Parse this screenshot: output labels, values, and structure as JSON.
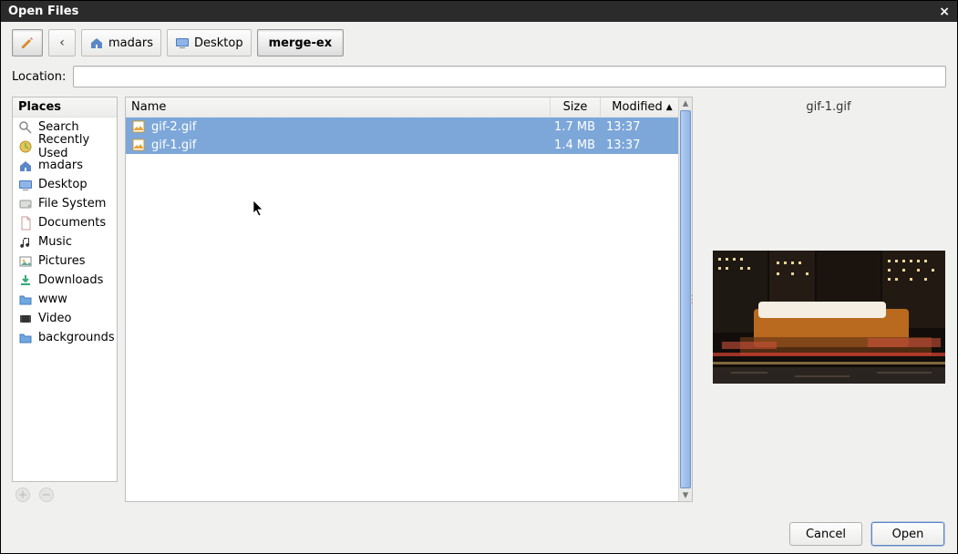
{
  "window": {
    "title": "Open Files"
  },
  "breadcrumb": {
    "items": [
      {
        "label": "madars",
        "icon": "home"
      },
      {
        "label": "Desktop",
        "icon": "desktop"
      },
      {
        "label": "merge-ex",
        "icon": null,
        "current": true
      }
    ]
  },
  "location": {
    "label": "Location:",
    "value": ""
  },
  "places": {
    "header": "Places",
    "items": [
      {
        "label": "Search",
        "icon": "search"
      },
      {
        "label": "Recently Used",
        "icon": "recent"
      },
      {
        "label": "madars",
        "icon": "home"
      },
      {
        "label": "Desktop",
        "icon": "desktop"
      },
      {
        "label": "File System",
        "icon": "drive"
      },
      {
        "label": "Documents",
        "icon": "doc"
      },
      {
        "label": "Music",
        "icon": "music"
      },
      {
        "label": "Pictures",
        "icon": "pictures"
      },
      {
        "label": "Downloads",
        "icon": "download"
      },
      {
        "label": "www",
        "icon": "folder"
      },
      {
        "label": "Video",
        "icon": "video"
      },
      {
        "label": "backgrounds",
        "icon": "folder"
      }
    ]
  },
  "files": {
    "columns": {
      "name": "Name",
      "size": "Size",
      "modified": "Modified"
    },
    "sort": {
      "column": "modified",
      "dir": "asc"
    },
    "rows": [
      {
        "name": "gif-2.gif",
        "size": "1.7 MB",
        "modified": "13:37",
        "selected": true
      },
      {
        "name": "gif-1.gif",
        "size": "1.4 MB",
        "modified": "13:37",
        "selected": true
      }
    ]
  },
  "preview": {
    "filename": "gif-1.gif"
  },
  "buttons": {
    "cancel": "Cancel",
    "open": "Open"
  }
}
